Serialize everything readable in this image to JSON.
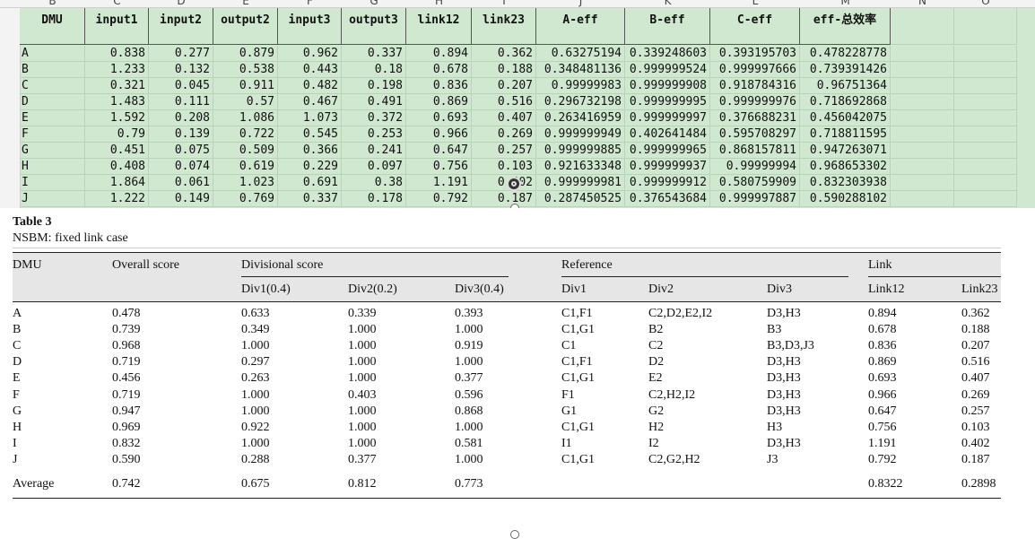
{
  "spreadsheet": {
    "column_letters": [
      "B",
      "C",
      "D",
      "E",
      "F",
      "G",
      "H",
      "I",
      "J",
      "K",
      "L",
      "M",
      "N",
      "O"
    ],
    "headers": [
      "DMU",
      "input1",
      "input2",
      "output2",
      "input3",
      "output3",
      "link12",
      "link23",
      "A-eff",
      "B-eff",
      "C-eff",
      "eff-总效率"
    ],
    "rows": [
      [
        "A",
        "0.838",
        "0.277",
        "0.879",
        "0.962",
        "0.337",
        "0.894",
        "0.362",
        "0.63275194",
        "0.339248603",
        "0.393195703",
        "0.478228778"
      ],
      [
        "B",
        "1.233",
        "0.132",
        "0.538",
        "0.443",
        "0.18",
        "0.678",
        "0.188",
        "0.348481136",
        "0.999999524",
        "0.999997666",
        "0.739391426"
      ],
      [
        "C",
        "0.321",
        "0.045",
        "0.911",
        "0.482",
        "0.198",
        "0.836",
        "0.207",
        "0.99999983",
        "0.999999908",
        "0.918784316",
        "0.96751364"
      ],
      [
        "D",
        "1.483",
        "0.111",
        "0.57",
        "0.467",
        "0.491",
        "0.869",
        "0.516",
        "0.296732198",
        "0.999999995",
        "0.999999976",
        "0.718692868"
      ],
      [
        "E",
        "1.592",
        "0.208",
        "1.086",
        "1.073",
        "0.372",
        "0.693",
        "0.407",
        "0.263416959",
        "0.999999997",
        "0.376688231",
        "0.456042075"
      ],
      [
        "F",
        "0.79",
        "0.139",
        "0.722",
        "0.545",
        "0.253",
        "0.966",
        "0.269",
        "0.999999949",
        "0.402641484",
        "0.595708297",
        "0.718811595"
      ],
      [
        "G",
        "0.451",
        "0.075",
        "0.509",
        "0.366",
        "0.241",
        "0.647",
        "0.257",
        "0.999999885",
        "0.999999965",
        "0.868157811",
        "0.947263071"
      ],
      [
        "H",
        "0.408",
        "0.074",
        "0.619",
        "0.229",
        "0.097",
        "0.756",
        "0.103",
        "0.921633348",
        "0.999999937",
        "0.99999994",
        "0.968653302"
      ],
      [
        "I",
        "1.864",
        "0.061",
        "1.023",
        "0.691",
        "0.38",
        "1.191",
        "0.402",
        "0.999999981",
        "0.999999912",
        "0.580759909",
        "0.832303938"
      ],
      [
        "J",
        "1.222",
        "0.149",
        "0.769",
        "0.337",
        "0.178",
        "0.792",
        "0.187",
        "0.287450525",
        "0.376543684",
        "0.999997887",
        "0.590288102"
      ]
    ],
    "colors": {
      "fill": "#cfe8cf",
      "grid": "#b9d3b9"
    }
  },
  "table3": {
    "title": "Table 3",
    "subtitle": "NSBM: fixed link case",
    "headers": {
      "dmu": "DMU",
      "overall": "Overall score",
      "divisional": "Divisional score",
      "reference": "Reference",
      "link": "Link",
      "div1w": "Div1(0.4)",
      "div2w": "Div2(0.2)",
      "div3w": "Div3(0.4)",
      "ref1": "Div1",
      "ref2": "Div2",
      "ref3": "Div3",
      "link12": "Link12",
      "link23": "Link23"
    },
    "rows": [
      [
        "A",
        "0.478",
        "0.633",
        "0.339",
        "0.393",
        "C1,F1",
        "C2,D2,E2,I2",
        "D3,H3",
        "0.894",
        "0.362"
      ],
      [
        "B",
        "0.739",
        "0.349",
        "1.000",
        "1.000",
        "C1,G1",
        "B2",
        "B3",
        "0.678",
        "0.188"
      ],
      [
        "C",
        "0.968",
        "1.000",
        "1.000",
        "0.919",
        "C1",
        "C2",
        "B3,D3,J3",
        "0.836",
        "0.207"
      ],
      [
        "D",
        "0.719",
        "0.297",
        "1.000",
        "1.000",
        "C1,F1",
        "D2",
        "D3,H3",
        "0.869",
        "0.516"
      ],
      [
        "E",
        "0.456",
        "0.263",
        "1.000",
        "0.377",
        "C1,G1",
        "E2",
        "D3,H3",
        "0.693",
        "0.407"
      ],
      [
        "F",
        "0.719",
        "1.000",
        "0.403",
        "0.596",
        "F1",
        "C2,H2,I2",
        "D3,H3",
        "0.966",
        "0.269"
      ],
      [
        "G",
        "0.947",
        "1.000",
        "1.000",
        "0.868",
        "G1",
        "G2",
        "D3,H3",
        "0.647",
        "0.257"
      ],
      [
        "H",
        "0.969",
        "0.922",
        "1.000",
        "1.000",
        "C1,G1",
        "H2",
        "H3",
        "0.756",
        "0.103"
      ],
      [
        "I",
        "0.832",
        "1.000",
        "1.000",
        "0.581",
        "I1",
        "I2",
        "D3,H3",
        "1.191",
        "0.402"
      ],
      [
        "J",
        "0.590",
        "0.288",
        "0.377",
        "1.000",
        "C1,G1",
        "C2,G2,H2",
        "J3",
        "0.792",
        "0.187"
      ]
    ],
    "average": [
      "Average",
      "0.742",
      "0.675",
      "0.812",
      "0.773",
      "",
      "",
      "",
      "0.8322",
      "0.2898"
    ]
  }
}
